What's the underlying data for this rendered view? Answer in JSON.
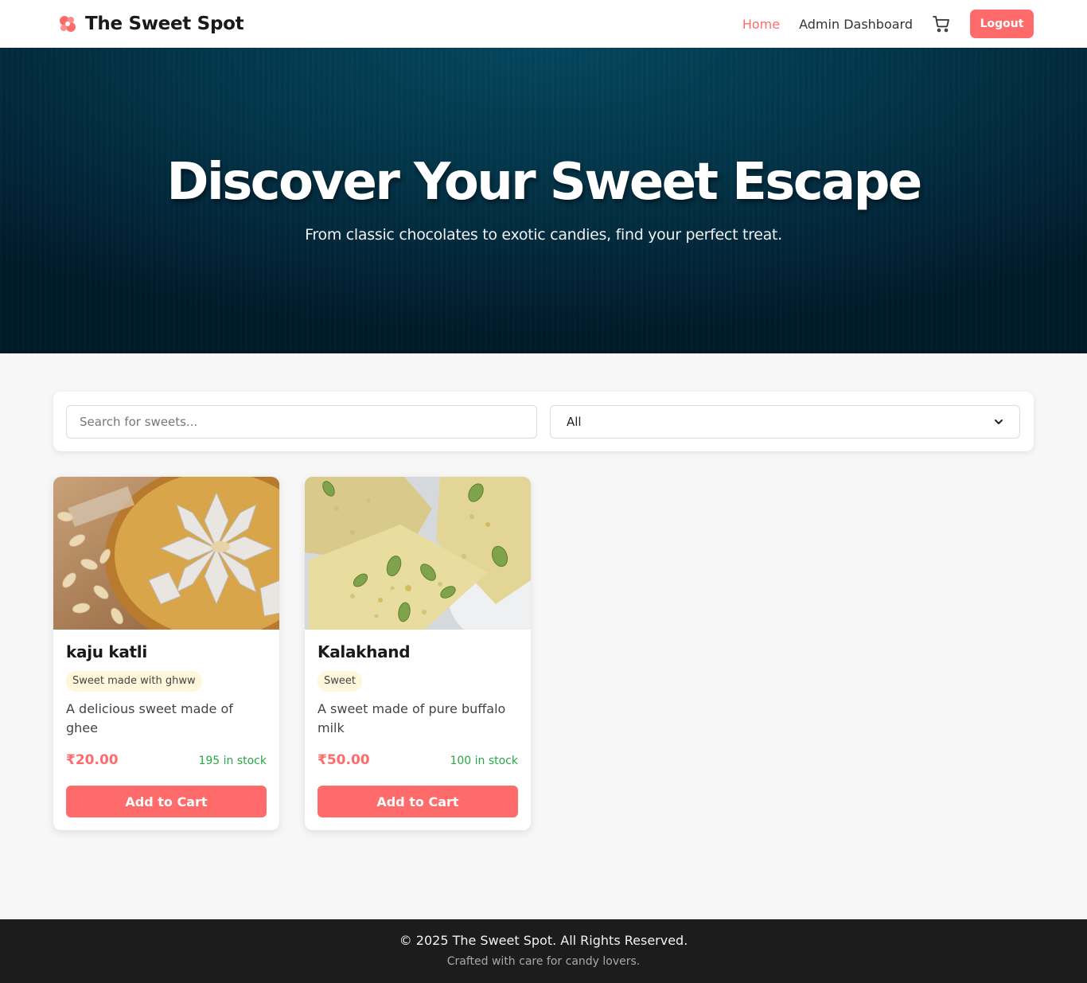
{
  "brand": {
    "name": "The Sweet Spot",
    "icon": "candy-icon"
  },
  "nav": {
    "home": "Home",
    "admin": "Admin Dashboard",
    "cart_icon": "cart-icon",
    "logout": "Logout"
  },
  "hero": {
    "title": "Discover Your Sweet Escape",
    "subtitle": "From classic chocolates to exotic candies, find your perfect treat."
  },
  "filters": {
    "search_placeholder": "Search for sweets...",
    "category_selected": "All"
  },
  "products": [
    {
      "name": "kaju katli",
      "tag": "Sweet made with ghww",
      "description": "A delicious sweet made of ghee",
      "price": "₹20.00",
      "stock": "195 in stock",
      "button": "Add to Cart"
    },
    {
      "name": "Kalakhand",
      "tag": "Sweet",
      "description": "A sweet made of pure buffalo milk",
      "price": "₹50.00",
      "stock": "100 in stock",
      "button": "Add to Cart"
    }
  ],
  "footer": {
    "copyright": "© 2025 The Sweet Spot. All Rights Reserved.",
    "tagline": "Crafted with care for candy lovers."
  },
  "colors": {
    "accent": "#ff6b6b",
    "stock": "#28a745",
    "hero": "#033549",
    "footer": "#1c1c1c"
  }
}
